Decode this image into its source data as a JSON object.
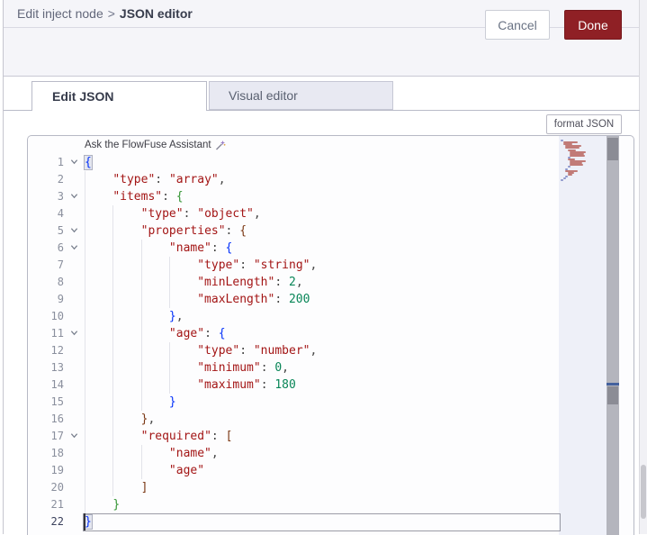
{
  "breadcrumb": {
    "parent": "Edit inject node",
    "separator": ">",
    "current": "JSON editor"
  },
  "actions": {
    "cancel_label": "Cancel",
    "done_label": "Done"
  },
  "tabs": [
    {
      "label": "Edit JSON",
      "active": true
    },
    {
      "label": "Visual editor",
      "active": false
    }
  ],
  "toolbar": {
    "format_button_label": "format JSON"
  },
  "assistant": {
    "label": "Ask the FlowFuse Assistant",
    "icon": "sparkle-pen-icon"
  },
  "colors": {
    "accent_red": "#8f2025",
    "header_bg": "#f5f5f9",
    "inactive_tab_bg": "#e8e9f2",
    "minimap_bg": "#eef0f8",
    "syntax": {
      "key": "#a31515",
      "string": "#a31515",
      "number": "#098658",
      "punct": "#454545",
      "bracket_depth1": "#0431fa",
      "bracket_depth2": "#319331",
      "bracket_depth3": "#7b3814"
    }
  },
  "editor": {
    "lines": [
      {
        "n": 1,
        "fold": true,
        "ind": 0,
        "tokens": [
          {
            "c": "b1 m",
            "t": "{"
          }
        ]
      },
      {
        "n": 2,
        "fold": false,
        "ind": 1,
        "tokens": [
          {
            "c": "k",
            "t": "\"type\""
          },
          {
            "c": "p",
            "t": ": "
          },
          {
            "c": "s",
            "t": "\"array\""
          },
          {
            "c": "p",
            "t": ","
          }
        ]
      },
      {
        "n": 3,
        "fold": true,
        "ind": 1,
        "tokens": [
          {
            "c": "k",
            "t": "\"items\""
          },
          {
            "c": "p",
            "t": ": "
          },
          {
            "c": "b2",
            "t": "{"
          }
        ]
      },
      {
        "n": 4,
        "fold": false,
        "ind": 2,
        "tokens": [
          {
            "c": "k",
            "t": "\"type\""
          },
          {
            "c": "p",
            "t": ": "
          },
          {
            "c": "s",
            "t": "\"object\""
          },
          {
            "c": "p",
            "t": ","
          }
        ]
      },
      {
        "n": 5,
        "fold": true,
        "ind": 2,
        "tokens": [
          {
            "c": "k",
            "t": "\"properties\""
          },
          {
            "c": "p",
            "t": ": "
          },
          {
            "c": "b3",
            "t": "{"
          }
        ]
      },
      {
        "n": 6,
        "fold": true,
        "ind": 3,
        "tokens": [
          {
            "c": "k",
            "t": "\"name\""
          },
          {
            "c": "p",
            "t": ": "
          },
          {
            "c": "b1",
            "t": "{"
          }
        ]
      },
      {
        "n": 7,
        "fold": false,
        "ind": 4,
        "tokens": [
          {
            "c": "k",
            "t": "\"type\""
          },
          {
            "c": "p",
            "t": ": "
          },
          {
            "c": "s",
            "t": "\"string\""
          },
          {
            "c": "p",
            "t": ","
          }
        ]
      },
      {
        "n": 8,
        "fold": false,
        "ind": 4,
        "tokens": [
          {
            "c": "k",
            "t": "\"minLength\""
          },
          {
            "c": "p",
            "t": ": "
          },
          {
            "c": "n",
            "t": "2"
          },
          {
            "c": "p",
            "t": ","
          }
        ]
      },
      {
        "n": 9,
        "fold": false,
        "ind": 4,
        "tokens": [
          {
            "c": "k",
            "t": "\"maxLength\""
          },
          {
            "c": "p",
            "t": ": "
          },
          {
            "c": "n",
            "t": "200"
          }
        ]
      },
      {
        "n": 10,
        "fold": false,
        "ind": 3,
        "tokens": [
          {
            "c": "b1",
            "t": "}"
          },
          {
            "c": "p",
            "t": ","
          }
        ]
      },
      {
        "n": 11,
        "fold": true,
        "ind": 3,
        "tokens": [
          {
            "c": "k",
            "t": "\"age\""
          },
          {
            "c": "p",
            "t": ": "
          },
          {
            "c": "b1",
            "t": "{"
          }
        ]
      },
      {
        "n": 12,
        "fold": false,
        "ind": 4,
        "tokens": [
          {
            "c": "k",
            "t": "\"type\""
          },
          {
            "c": "p",
            "t": ": "
          },
          {
            "c": "s",
            "t": "\"number\""
          },
          {
            "c": "p",
            "t": ","
          }
        ]
      },
      {
        "n": 13,
        "fold": false,
        "ind": 4,
        "tokens": [
          {
            "c": "k",
            "t": "\"minimum\""
          },
          {
            "c": "p",
            "t": ": "
          },
          {
            "c": "n",
            "t": "0"
          },
          {
            "c": "p",
            "t": ","
          }
        ]
      },
      {
        "n": 14,
        "fold": false,
        "ind": 4,
        "tokens": [
          {
            "c": "k",
            "t": "\"maximum\""
          },
          {
            "c": "p",
            "t": ": "
          },
          {
            "c": "n",
            "t": "180"
          }
        ]
      },
      {
        "n": 15,
        "fold": false,
        "ind": 3,
        "tokens": [
          {
            "c": "b1",
            "t": "}"
          }
        ]
      },
      {
        "n": 16,
        "fold": false,
        "ind": 2,
        "tokens": [
          {
            "c": "b3",
            "t": "}"
          },
          {
            "c": "p",
            "t": ","
          }
        ]
      },
      {
        "n": 17,
        "fold": true,
        "ind": 2,
        "tokens": [
          {
            "c": "k",
            "t": "\"required\""
          },
          {
            "c": "p",
            "t": ": "
          },
          {
            "c": "b3",
            "t": "["
          }
        ]
      },
      {
        "n": 18,
        "fold": false,
        "ind": 3,
        "tokens": [
          {
            "c": "s",
            "t": "\"name\""
          },
          {
            "c": "p",
            "t": ","
          }
        ]
      },
      {
        "n": 19,
        "fold": false,
        "ind": 3,
        "tokens": [
          {
            "c": "s",
            "t": "\"age\""
          }
        ]
      },
      {
        "n": 20,
        "fold": false,
        "ind": 2,
        "tokens": [
          {
            "c": "b3",
            "t": "]"
          }
        ]
      },
      {
        "n": 21,
        "fold": false,
        "ind": 1,
        "tokens": [
          {
            "c": "b2",
            "t": "}"
          }
        ]
      },
      {
        "n": 22,
        "fold": false,
        "ind": 0,
        "current": true,
        "tokens": [
          {
            "c": "b1 m",
            "t": "}"
          }
        ]
      }
    ]
  }
}
